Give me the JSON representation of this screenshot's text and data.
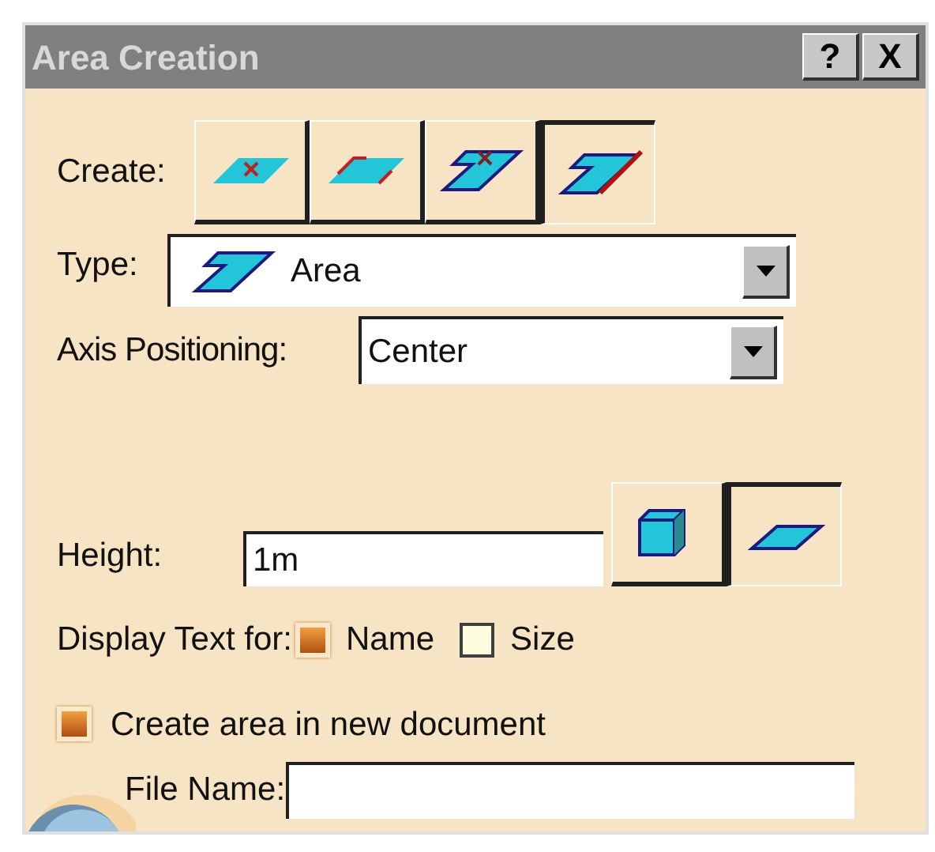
{
  "window": {
    "title": "Area Creation",
    "help_button": "?",
    "close_button": "X"
  },
  "create": {
    "label": "Create:",
    "options": [
      {
        "kind": "point",
        "selected": false
      },
      {
        "kind": "edge",
        "selected": false
      },
      {
        "kind": "polygon-point",
        "selected": false
      },
      {
        "kind": "polygon-edge",
        "selected": true
      }
    ]
  },
  "type": {
    "label": "Type:",
    "value": "Area"
  },
  "axis_positioning": {
    "label": "Axis Positioning:",
    "value": "Center"
  },
  "height": {
    "label": "Height:",
    "value": "1m",
    "modes": [
      {
        "kind": "box",
        "selected": false
      },
      {
        "kind": "flat",
        "selected": true
      }
    ]
  },
  "display_text": {
    "label": "Display Text for:",
    "options": [
      {
        "label": "Name",
        "checked": true
      },
      {
        "label": "Size",
        "checked": false
      }
    ]
  },
  "new_document": {
    "label": "Create area in new document",
    "checked": true
  },
  "file_name": {
    "label": "File Name:"
  }
}
